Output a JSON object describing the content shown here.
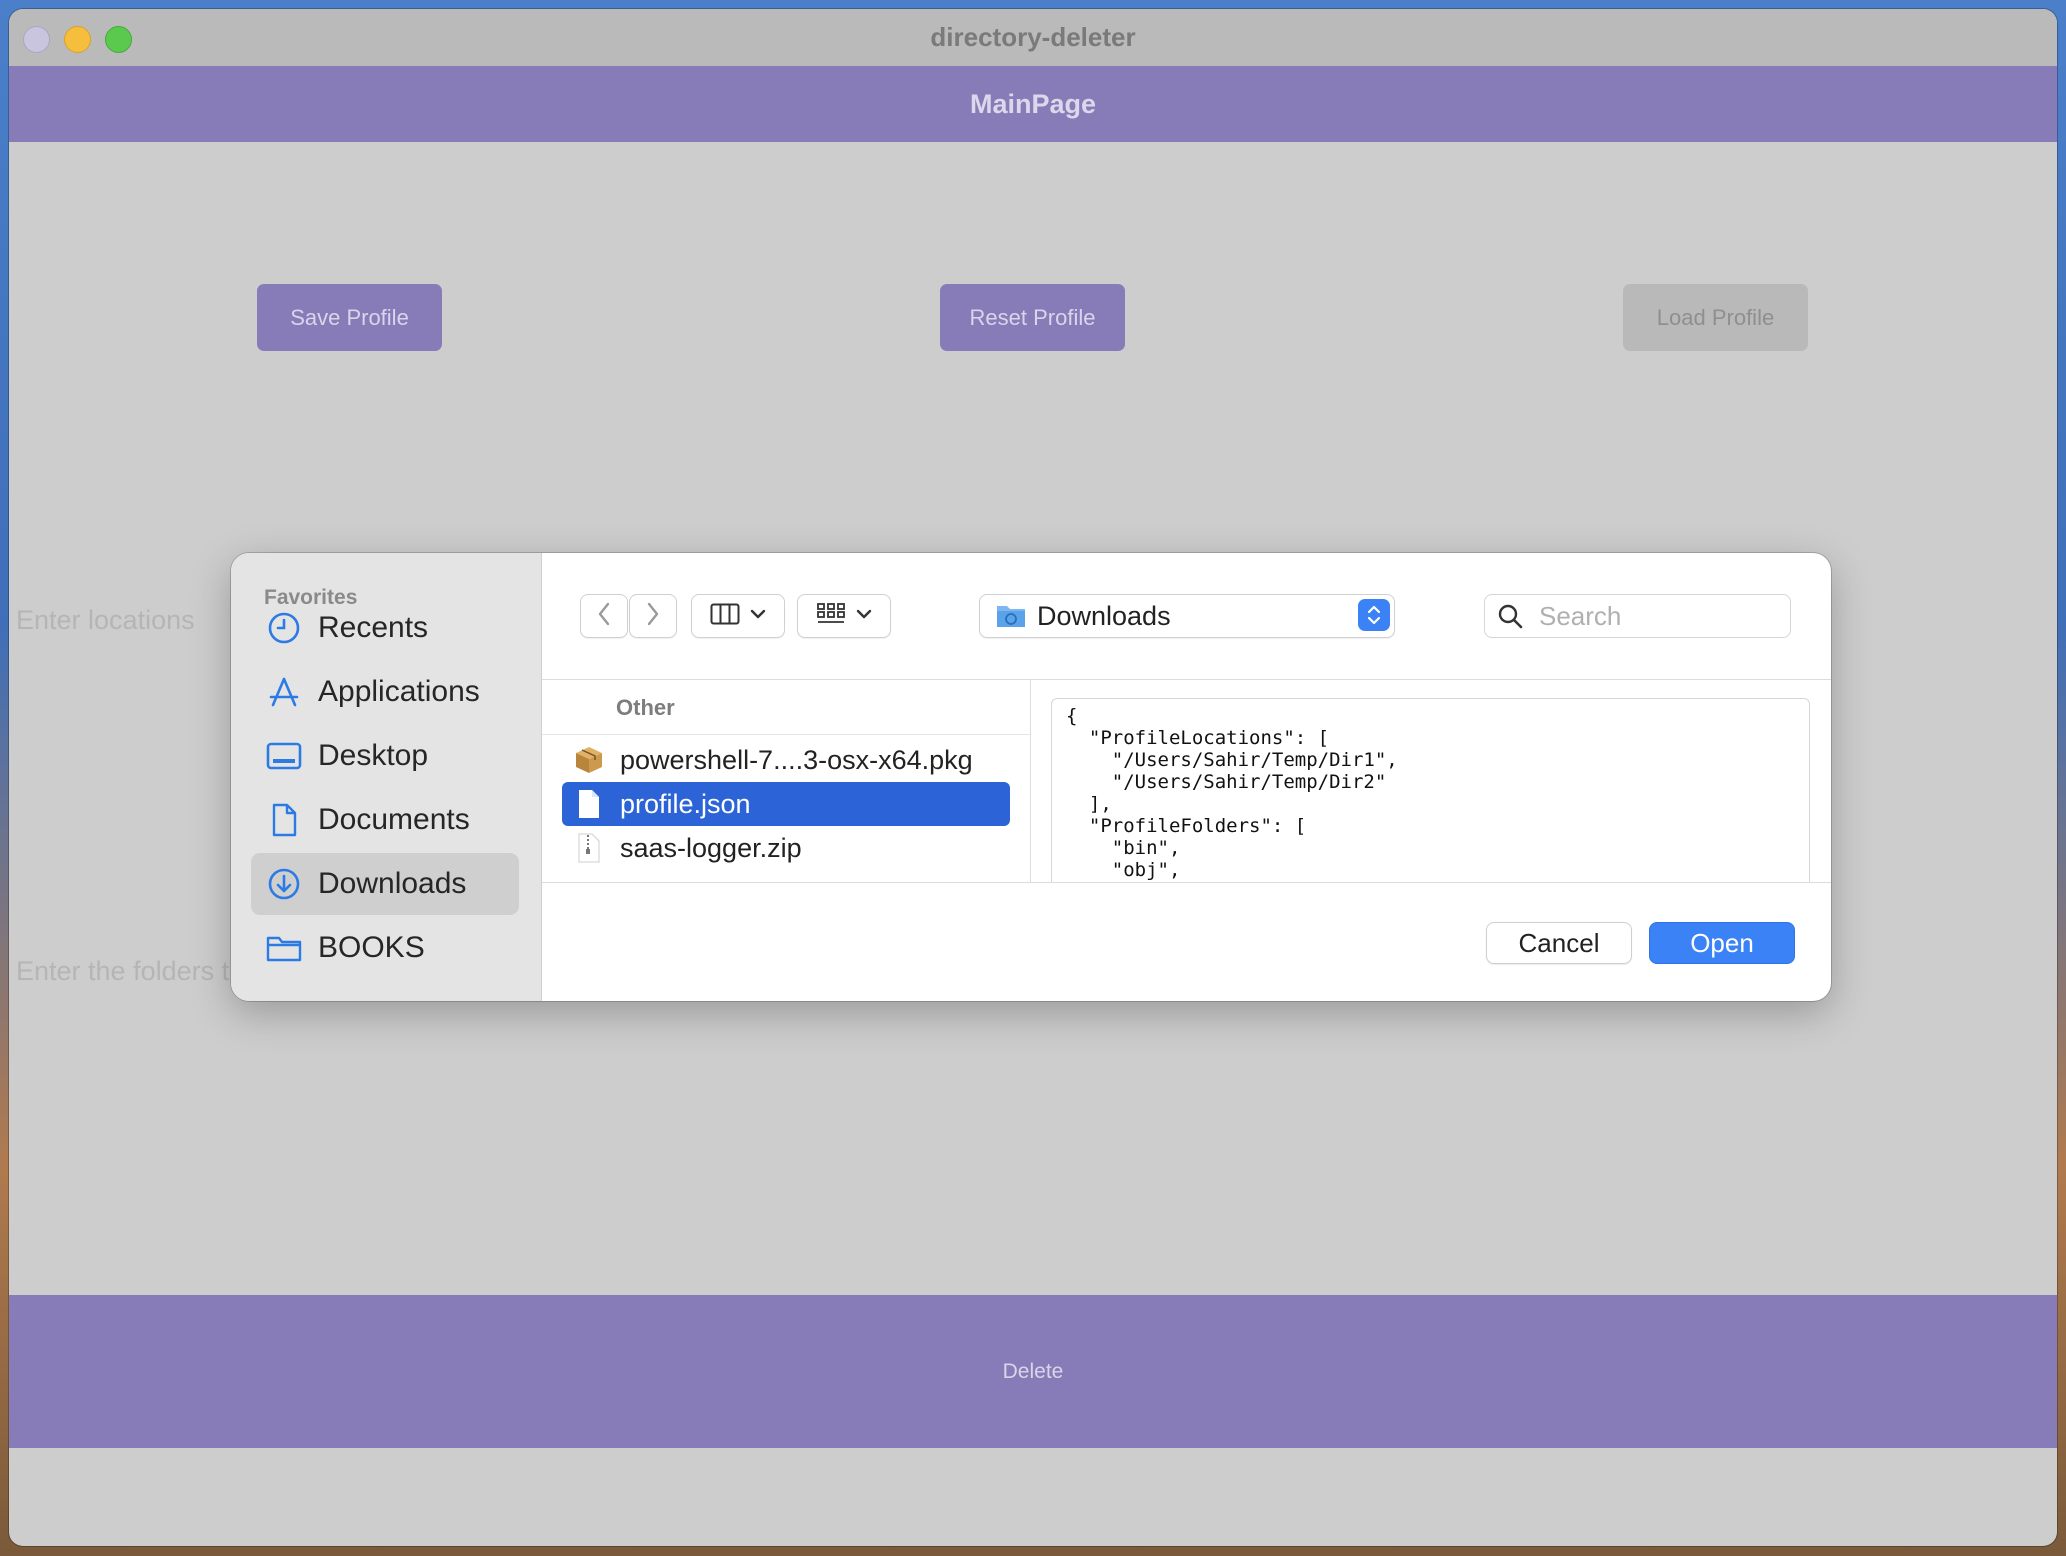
{
  "window": {
    "title": "directory-deleter"
  },
  "navbar": {
    "title": "MainPage"
  },
  "buttons": {
    "save": "Save Profile",
    "reset": "Reset Profile",
    "load": "Load Profile"
  },
  "hints": {
    "locations": "Enter locations",
    "folders": "Enter the folders t"
  },
  "delete_label": "Delete",
  "dialog": {
    "sidebar": {
      "title": "Favorites",
      "items": [
        {
          "label": "Recents",
          "icon": "clock-icon"
        },
        {
          "label": "Applications",
          "icon": "applications-icon"
        },
        {
          "label": "Desktop",
          "icon": "desktop-icon"
        },
        {
          "label": "Documents",
          "icon": "document-icon"
        },
        {
          "label": "Downloads",
          "icon": "download-icon",
          "active": true
        },
        {
          "label": "BOOKS",
          "icon": "folder-icon"
        }
      ]
    },
    "location": "Downloads",
    "search": {
      "placeholder": "Search",
      "value": ""
    },
    "column_header": "Other",
    "files": [
      {
        "name": "powershell-7....3-osx-x64.pkg",
        "icon": "package-icon"
      },
      {
        "name": "profile.json",
        "icon": "file-icon",
        "selected": true
      },
      {
        "name": "saas-logger.zip",
        "icon": "zip-icon"
      }
    ],
    "preview": "{\n  \"ProfileLocations\": [\n    \"/Users/Sahir/Temp/Dir1\",\n    \"/Users/Sahir/Temp/Dir2\"\n  ],\n  \"ProfileFolders\": [\n    \"bin\",\n    \"obj\",",
    "cancel": "Cancel",
    "open": "Open"
  },
  "colors": {
    "accent": "#877cb8",
    "selection": "#2c64d8",
    "primary_button": "#3b82f6"
  }
}
